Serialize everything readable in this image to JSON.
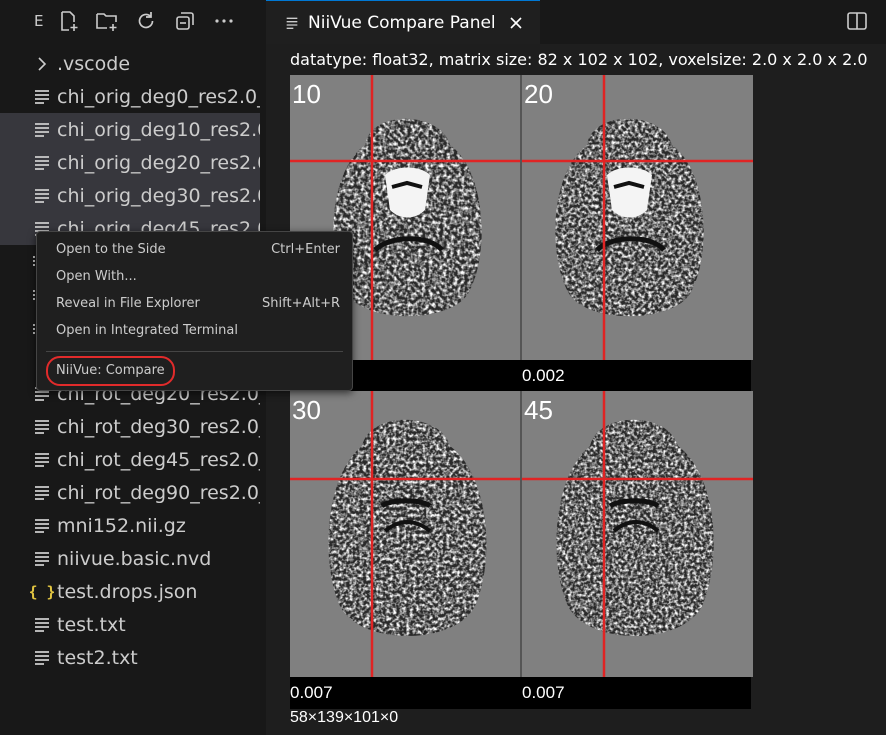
{
  "sidebar": {
    "title": "E",
    "toolbar_icons": [
      "new-file-icon",
      "new-folder-icon",
      "refresh-icon",
      "collapse-all-icon",
      "more-icon"
    ],
    "items": [
      {
        "label": ".vscode",
        "icon": "chevron-right-icon"
      },
      {
        "label": "chi_orig_deg0_res2.0_...",
        "icon": "file-lines-icon"
      },
      {
        "label": "chi_orig_deg10_res2.0_...",
        "icon": "file-lines-icon"
      },
      {
        "label": "chi_orig_deg20_res2.0...",
        "icon": "file-lines-icon"
      },
      {
        "label": "chi_orig_deg30_res2.0...",
        "icon": "file-lines-icon"
      },
      {
        "label": "chi_orig_deg45_res2.0...",
        "icon": "file-lines-icon"
      },
      {
        "label": "chi_rot_deg20_res2.0_...",
        "icon": "file-lines-icon"
      },
      {
        "label": "chi_rot_deg30_res2.0_...",
        "icon": "file-lines-icon"
      },
      {
        "label": "chi_rot_deg45_res2.0_...",
        "icon": "file-lines-icon"
      },
      {
        "label": "chi_rot_deg90_res2.0_...",
        "icon": "file-lines-icon"
      },
      {
        "label": "mni152.nii.gz",
        "icon": "file-lines-icon"
      },
      {
        "label": "niivue.basic.nvd",
        "icon": "file-lines-icon"
      },
      {
        "label": "test.drops.json",
        "icon": "json-braces-icon"
      },
      {
        "label": "test.txt",
        "icon": "file-lines-icon"
      },
      {
        "label": "test2.txt",
        "icon": "file-lines-icon"
      }
    ]
  },
  "context_menu": {
    "items": [
      {
        "label": "Open to the Side",
        "shortcut": "Ctrl+Enter"
      },
      {
        "label": "Open With...",
        "shortcut": ""
      },
      {
        "label": "Reveal in File Explorer",
        "shortcut": "Shift+Alt+R"
      },
      {
        "label": "Open in Integrated Terminal",
        "shortcut": ""
      },
      {
        "label": "NiiVue: Compare",
        "shortcut": ""
      }
    ]
  },
  "editor": {
    "tab": {
      "title": "NiiVue Compare Panel",
      "icon": "file-lines-icon",
      "close_icon": "close-icon"
    },
    "split_icon": "split-editor-icon",
    "info": "datatype: float32, matrix size: 82 x 102 x 102, voxelsize: 2.0 x 2.0 x 2.0",
    "panels": [
      {
        "label": "10",
        "value": ""
      },
      {
        "label": "20",
        "value": "0.002"
      },
      {
        "label": "30",
        "value": "0.007"
      },
      {
        "label": "45",
        "value": "0.007"
      }
    ],
    "footer": "58×139×101×0"
  },
  "colors": {
    "crosshair": "#e02424",
    "highlight_ring": "#e12b2b",
    "panel_bg": "#808080",
    "accent": "#0078d4",
    "json_icon": "#e2c541"
  }
}
